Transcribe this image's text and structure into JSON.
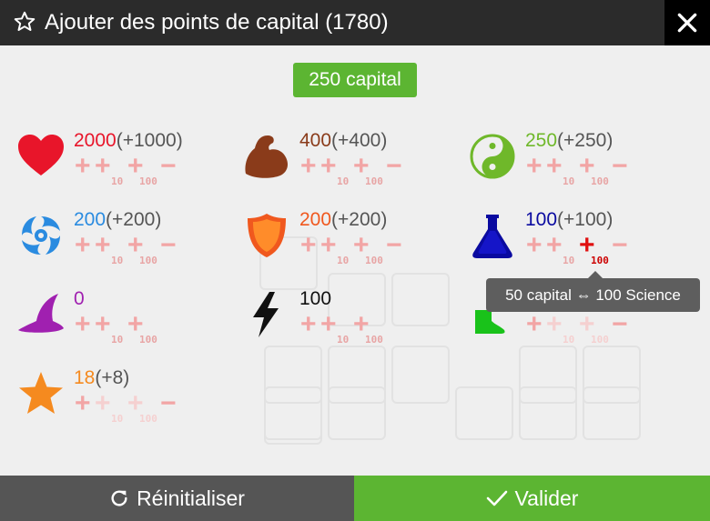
{
  "dialog": {
    "title": "Ajouter des points de capital (1780)",
    "close_icon": "close-icon",
    "title_icon": "star-outline-icon"
  },
  "capital_badge": "250 capital",
  "stats": [
    {
      "id": "vitality",
      "icon": "heart-icon",
      "color": "#e8152a",
      "value": "2000",
      "bonus": "(+1000)"
    },
    {
      "id": "strength",
      "icon": "flexed-arm-icon",
      "color": "#8a3b1a",
      "value": "400",
      "bonus": "(+400)"
    },
    {
      "id": "wisdom",
      "icon": "yin-yang-icon",
      "color": "#6fb82a",
      "value": "250",
      "bonus": "(+250)"
    },
    {
      "id": "agility",
      "icon": "swirl-icon",
      "color": "#2a8be0",
      "value": "200",
      "bonus": "(+200)"
    },
    {
      "id": "resistance",
      "icon": "shield-icon",
      "color": "#f0581e",
      "value": "200",
      "bonus": "(+200)"
    },
    {
      "id": "science",
      "icon": "flask-icon",
      "color": "#0a0aa0",
      "value": "100",
      "bonus": "(+100)"
    },
    {
      "id": "magic",
      "icon": "witch-hat-icon",
      "color": "#a020b0",
      "value": "0",
      "bonus": ""
    },
    {
      "id": "energy",
      "icon": "lightning-icon",
      "color": "#111111",
      "value": "100",
      "bonus": ""
    },
    {
      "id": "speed",
      "icon": "boot-icon",
      "color": "#19c21a",
      "value": "",
      "bonus": ""
    },
    {
      "id": "level",
      "icon": "star-icon",
      "color": "#f58a1f",
      "value": "18",
      "bonus": "(+8)"
    }
  ],
  "increments": {
    "plus_symbol": "+",
    "minus_symbol": "−",
    "ten": "10",
    "hundred": "100"
  },
  "tooltip": "50 capital ⇔ 100 Science",
  "footer": {
    "reset_label": "Réinitialiser",
    "reset_icon": "refresh-icon",
    "ok_label": "Valider",
    "ok_icon": "check-icon"
  }
}
